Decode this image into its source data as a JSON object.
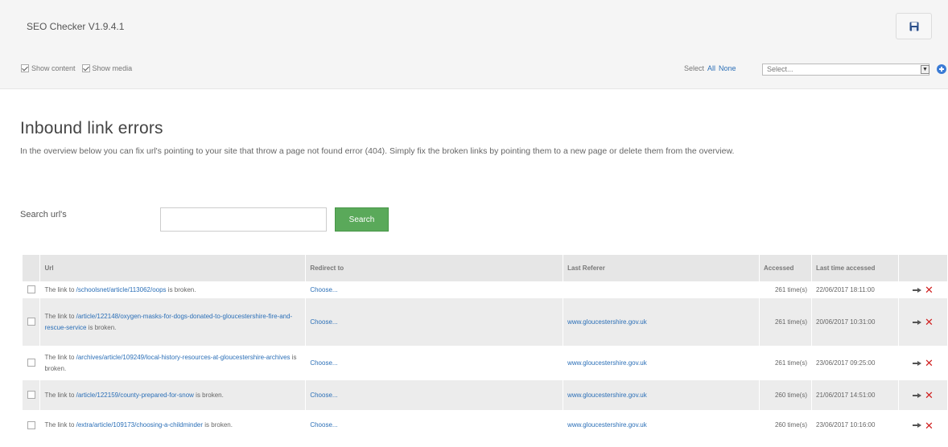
{
  "app": {
    "title": "SEO Checker V1.9.4.1"
  },
  "options": {
    "show_content": "Show content",
    "show_media": "Show media"
  },
  "selector": {
    "label": "Select",
    "all": "All",
    "none": "None",
    "placeholder": "Select..."
  },
  "section": {
    "title": "Inbound link errors",
    "description": "In the overview below you can fix url's pointing to your site that throw a page not found error (404). Simply fix the broken links by pointing them to a new page or delete them from the overview."
  },
  "search": {
    "label": "Search url's",
    "value": "",
    "button": "Search"
  },
  "table": {
    "headers": {
      "url": "Url",
      "redirect": "Redirect to",
      "referer": "Last Referer",
      "accessed": "Accessed",
      "last_accessed": "Last time accessed"
    },
    "rows": [
      {
        "prefix": "The link to ",
        "url": "/schoolsnet/article/113062/oops",
        "suffix": " is broken.",
        "redirect": "Choose...",
        "referer": "",
        "accessed": "261 time(s)",
        "last": "22/06/2017 18:11:00"
      },
      {
        "prefix": "The link to ",
        "url": "/article/122148/oxygen-masks-for-dogs-donated-to-gloucestershire-fire-and-rescue-service",
        "suffix": " is broken.",
        "redirect": "Choose...",
        "referer": "www.gloucestershire.gov.uk",
        "accessed": "261 time(s)",
        "last": "20/06/2017 10:31:00"
      },
      {
        "prefix": "The link to ",
        "url": "/archives/article/109249/local-history-resources-at-gloucestershire-archives",
        "suffix": " is broken.",
        "redirect": "Choose...",
        "referer": "www.gloucestershire.gov.uk",
        "accessed": "261 time(s)",
        "last": "23/06/2017 09:25:00"
      },
      {
        "prefix": "The link to ",
        "url": "/article/122159/county-prepared-for-snow",
        "suffix": " is broken.",
        "redirect": "Choose...",
        "referer": "www.gloucestershire.gov.uk",
        "accessed": "260 time(s)",
        "last": "21/06/2017 14:51:00"
      },
      {
        "prefix": "The link to ",
        "url": "/extra/article/109173/choosing-a-childminder",
        "suffix": " is broken.",
        "redirect": "Choose...",
        "referer": "www.gloucestershire.gov.uk",
        "accessed": "260 time(s)",
        "last": "23/06/2017 10:16:00"
      }
    ]
  },
  "colors": {
    "accent": "#2b6fb7",
    "search_button": "#5aa95a",
    "delete": "#d02020"
  },
  "icons": {
    "save": "floppy-disk-icon",
    "add": "plus-circle-icon",
    "redirect": "arrow-right-icon",
    "delete": "close-x-icon"
  }
}
